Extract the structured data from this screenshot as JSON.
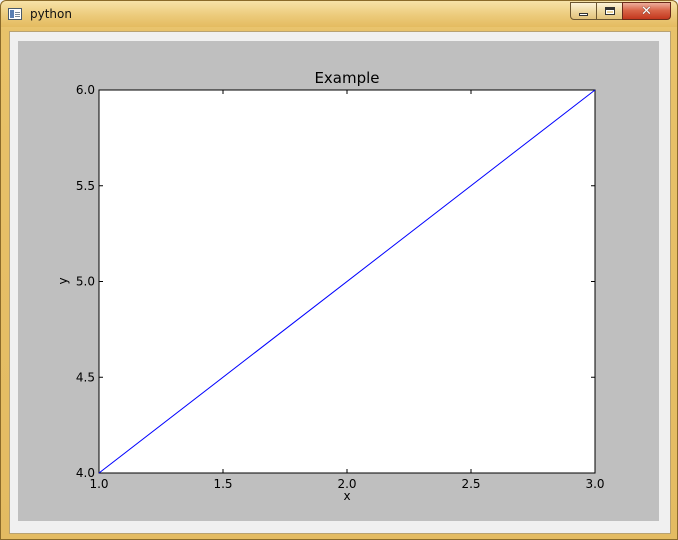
{
  "window": {
    "title": "python",
    "app_icon": "python-app-icon",
    "controls": {
      "minimize_icon": "minimize-icon",
      "maximize_icon": "maximize-icon",
      "close_icon": "close-icon",
      "close_glyph": "✕"
    }
  },
  "chart_data": {
    "type": "line",
    "title": "Example",
    "xlabel": "x",
    "ylabel": "y",
    "xlim": [
      1.0,
      3.0
    ],
    "ylim": [
      4.0,
      6.0
    ],
    "xticks": [
      "1.0",
      "1.5",
      "2.0",
      "2.5",
      "3.0"
    ],
    "yticks": [
      "4.0",
      "4.5",
      "5.0",
      "5.5",
      "6.0"
    ],
    "grid": false,
    "series": [
      {
        "x": [
          1.0,
          3.0
        ],
        "y": [
          4.0,
          6.0
        ],
        "color": "#0000ff"
      }
    ],
    "colors": {
      "figure_bg": "#bfbfbf",
      "axes_bg": "#ffffff",
      "line": "#0000ff"
    }
  }
}
